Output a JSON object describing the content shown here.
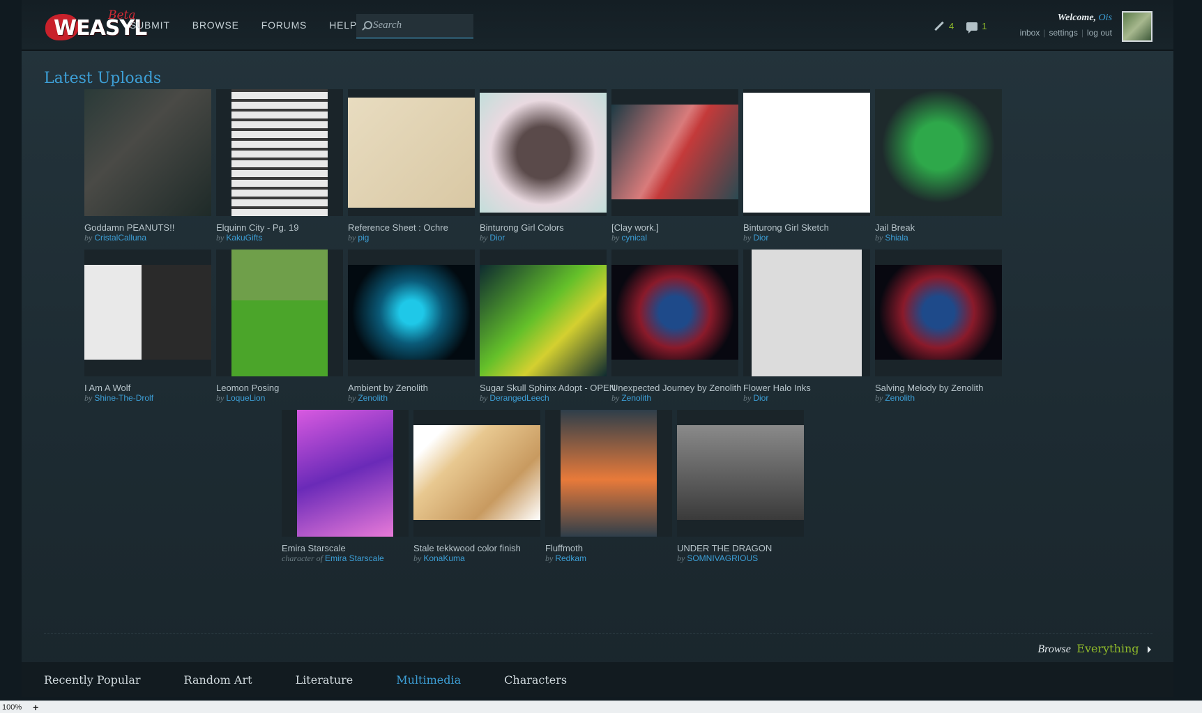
{
  "header": {
    "logo_text": "WEASYL",
    "logo_beta": "Beta",
    "nav": [
      "SUBMIT",
      "BROWSE",
      "FORUMS",
      "HELP"
    ],
    "search_placeholder": "Search",
    "submissions_count": "4",
    "comments_count": "1",
    "welcome": "Welcome,",
    "username": "Ois",
    "links": [
      "inbox",
      "settings",
      "log out"
    ]
  },
  "section_title": "Latest Uploads",
  "uploads": [
    {
      "title": "Goddamn PEANUTS!!",
      "by": "by",
      "user": "CristalCalluna"
    },
    {
      "title": "Elquinn City - Pg. 19",
      "by": "by",
      "user": "KakuGifts"
    },
    {
      "title": "Reference Sheet : Ochre",
      "by": "by",
      "user": "pig"
    },
    {
      "title": "Binturong Girl Colors",
      "by": "by",
      "user": "Dior"
    },
    {
      "title": "[Clay work.]",
      "by": "by",
      "user": "cynical"
    },
    {
      "title": "Binturong Girl Sketch",
      "by": "by",
      "user": "Dior"
    },
    {
      "title": "Jail Break",
      "by": "by",
      "user": "Shiala"
    },
    {
      "title": "I Am A Wolf",
      "by": "by",
      "user": "Shine-The-Drolf"
    },
    {
      "title": "Leomon Posing",
      "by": "by",
      "user": "LoqueLion"
    },
    {
      "title": "Ambient by Zenolith",
      "by": "by",
      "user": "Zenolith"
    },
    {
      "title": "Sugar Skull Sphinx Adopt - OPEN",
      "by": "by",
      "user": "DerangedLeech"
    },
    {
      "title": "Unexpected Journey by Zenolith",
      "by": "by",
      "user": "Zenolith"
    },
    {
      "title": "Flower Halo Inks",
      "by": "by",
      "user": "Dior"
    },
    {
      "title": "Salving Melody by Zenolith",
      "by": "by",
      "user": "Zenolith"
    },
    {
      "title": "Emira Starscale",
      "by": "character of",
      "user": "Emira Starscale"
    },
    {
      "title": "Stale tekkwood color finish",
      "by": "by",
      "user": "KonaKuma"
    },
    {
      "title": "Fluffmoth",
      "by": "by",
      "user": "Redkam"
    },
    {
      "title": "UNDER THE DRAGON",
      "by": "by",
      "user": "SOMNIVAGRIOUS"
    }
  ],
  "browse": {
    "label": "Browse",
    "link": "Everything"
  },
  "tabs": [
    "Recently Popular",
    "Random Art",
    "Literature",
    "Multimedia",
    "Characters"
  ],
  "active_tab": "Multimedia",
  "statusbar": {
    "zoom": "100%",
    "plus": "+"
  }
}
